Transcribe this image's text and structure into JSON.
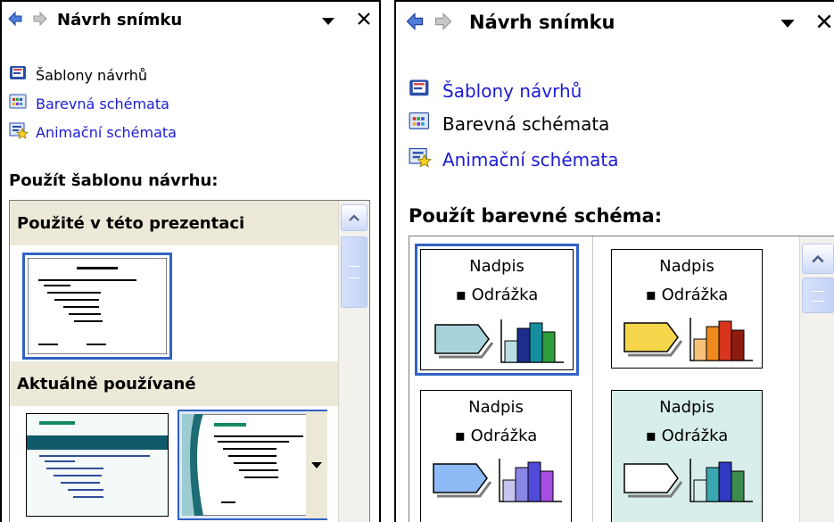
{
  "title": "Návrh snímku",
  "links": {
    "templates": "Šablony návrhů",
    "color_schemes": "Barevná schémata",
    "animation_schemes": "Animační schémata"
  },
  "left": {
    "section_title": "Použít šablonu návrhu:",
    "group_used": "Použité v této prezentaci",
    "group_recent": "Aktuálně používané"
  },
  "right": {
    "section_title": "Použít barevné schéma:",
    "scheme_title": "Nadpis",
    "scheme_bullet": "Odrážka"
  },
  "colors": {
    "link": "#1c1cd6",
    "selection": "#3162c5",
    "group_bg": "#ece9d8",
    "scheme_selected_bg": "#d8eeea"
  },
  "schemes": [
    {
      "arrow": "#a9d3db",
      "bars": [
        "#b9dde4",
        "#1e2d8c",
        "#158fa0",
        "#2d9e3a"
      ]
    },
    {
      "arrow": "#f5d64a",
      "bars": [
        "#f6c27a",
        "#f08a1e",
        "#d8351c",
        "#8c1c10"
      ]
    },
    {
      "arrow": "#8ebbf5",
      "bars": [
        "#c8c4f0",
        "#8a86e6",
        "#4f4ad8",
        "#a64ee0"
      ]
    },
    {
      "arrow": "#ffffff",
      "bars": [
        "#d8eeea",
        "#3aa7b2",
        "#2f39c2",
        "#3c8c4e"
      ]
    }
  ]
}
